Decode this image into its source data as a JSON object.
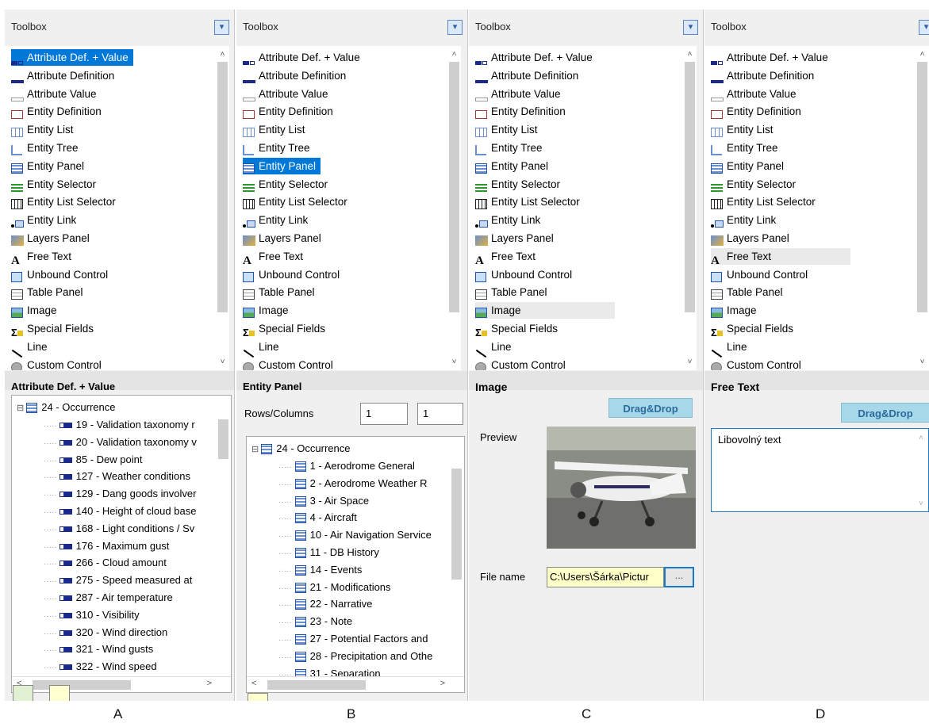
{
  "toolbox_title": "Toolbox",
  "toolbox_items": [
    {
      "label": "Attribute Def. + Value",
      "icon": "attribute-def-value-icon"
    },
    {
      "label": "Attribute Definition",
      "icon": "attribute-definition-icon"
    },
    {
      "label": "Attribute Value",
      "icon": "attribute-value-icon"
    },
    {
      "label": "Entity Definition",
      "icon": "entity-definition-icon"
    },
    {
      "label": "Entity List",
      "icon": "entity-list-icon"
    },
    {
      "label": "Entity Tree",
      "icon": "entity-tree-icon"
    },
    {
      "label": "Entity Panel",
      "icon": "entity-panel-icon"
    },
    {
      "label": "Entity Selector",
      "icon": "entity-selector-icon"
    },
    {
      "label": "Entity List Selector",
      "icon": "entity-list-selector-icon"
    },
    {
      "label": "Entity Link",
      "icon": "entity-link-icon"
    },
    {
      "label": "Layers Panel",
      "icon": "layers-panel-icon"
    },
    {
      "label": "Free Text",
      "icon": "free-text-icon"
    },
    {
      "label": "Unbound Control",
      "icon": "unbound-control-icon"
    },
    {
      "label": "Table Panel",
      "icon": "table-panel-icon"
    },
    {
      "label": "Image",
      "icon": "image-icon"
    },
    {
      "label": "Special Fields",
      "icon": "special-fields-icon"
    },
    {
      "label": "Line",
      "icon": "line-icon"
    },
    {
      "label": "Custom Control",
      "icon": "custom-control-icon"
    }
  ],
  "panelA": {
    "section_title": "Attribute Def. + Value",
    "tree_root": "24 - Occurrence",
    "tree_items": [
      "19 - Validation taxonomy r",
      "20 - Validation taxonomy v",
      "85 - Dew point",
      "127 - Weather conditions",
      "129 - Dang goods involver",
      "140 - Height of cloud base",
      "168 - Light conditions / Sv",
      "176 - Maximum gust",
      "266 - Cloud amount",
      "275 - Speed measured at",
      "287 - Air temperature",
      "310 - Visibility",
      "320 - Wind direction",
      "321 - Wind gusts",
      "322 - Wind speed"
    ],
    "caption": "A"
  },
  "panelB": {
    "section_title": "Entity Panel",
    "rows_cols_label": "Rows/Columns",
    "rows_value": "1",
    "cols_value": "1",
    "tree_root": "24 - Occurrence",
    "tree_items": [
      "1 - Aerodrome General",
      "2 - Aerodrome Weather R",
      "3 - Air Space",
      "4 - Aircraft",
      "10 - Air Navigation Service",
      "11 - DB History",
      "14 - Events",
      "21 - Modifications",
      "22 - Narrative",
      "23 - Note",
      "27 - Potential Factors and",
      "28 - Precipitation and Othe",
      "31 - Separation"
    ],
    "caption": "B"
  },
  "panelC": {
    "section_title": "Image",
    "dragdrop_label": "Drag&Drop",
    "preview_label": "Preview",
    "file_name_label": "File name",
    "file_name_value": "C:\\Users\\Šárka\\Pictur",
    "browse_label": "...",
    "caption": "C"
  },
  "panelD": {
    "section_title": "Free Text",
    "dragdrop_label": "Drag&Drop",
    "text_value": "Libovolný text",
    "caption": "D"
  },
  "colors": {
    "selection": "#0078d7",
    "dragdrop": "#a6d8ea"
  }
}
